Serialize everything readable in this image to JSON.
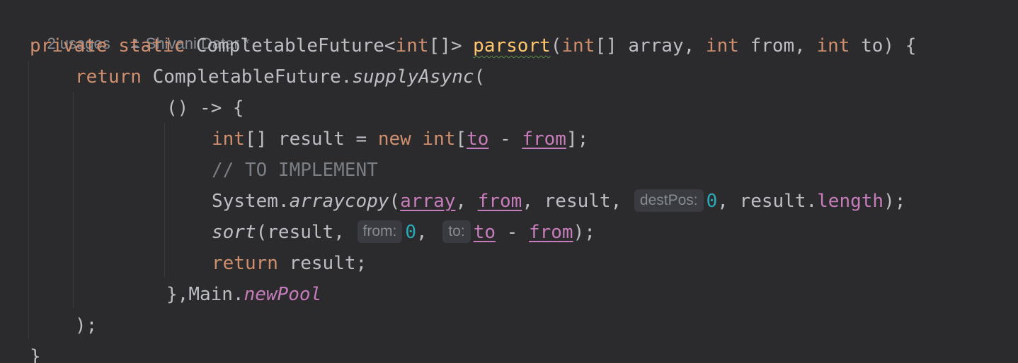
{
  "codelens": {
    "usages": "2 usages",
    "author": "Shivani Datar *"
  },
  "code": {
    "l1": {
      "kw_private": "private",
      "kw_static": "static",
      "type": "CompletableFuture<",
      "kw_int1": "int",
      "type_end": "[]>",
      "method": "parsort",
      "open": "(",
      "kw_int2": "int",
      "arr": "[] array, ",
      "kw_int3": "int",
      "from": " from, ",
      "kw_int4": "int",
      "to": " to) {"
    },
    "l2": {
      "kw_return": "return",
      "cls": " CompletableFuture.",
      "method": "supplyAsync",
      "paren": "("
    },
    "l3": {
      "lambda": "() -> {"
    },
    "l4": {
      "kw_int": "int",
      "decl": "[] result = ",
      "kw_new": "new",
      "kw_int2": "int",
      "bracket": "[",
      "to": "to",
      "minus": " - ",
      "from": "from",
      "end": "];"
    },
    "l5": {
      "comment": "// TO IMPLEMENT"
    },
    "l6": {
      "cls": "System.",
      "method": "arraycopy",
      "open": "(",
      "array": "array",
      "comma1": ", ",
      "from": "from",
      "comma2": ", result, ",
      "hint": "destPos:",
      "zero": "0",
      "rest": ", result.",
      "length": "length",
      "end": ");"
    },
    "l7": {
      "method": "sort",
      "open": "(result, ",
      "hint_from": "from:",
      "zero": "0",
      "comma": ", ",
      "hint_to": "to:",
      "to": "to",
      "minus": " - ",
      "from": "from",
      "end": ");"
    },
    "l8": {
      "kw_return": "return",
      "rest": " result;"
    },
    "l9": {
      "close": "},",
      "cls": "Main.",
      "field": "newPool"
    },
    "l10": {
      "close": ");"
    },
    "l11": {
      "close": "}"
    }
  },
  "colors": {
    "background": "#2b2b2d",
    "keyword": "#cf8e6d",
    "text": "#bcbec4",
    "field": "#c77dbb",
    "number": "#2aacb8",
    "comment": "#7a7e85",
    "method_decl": "#ffc66d"
  }
}
